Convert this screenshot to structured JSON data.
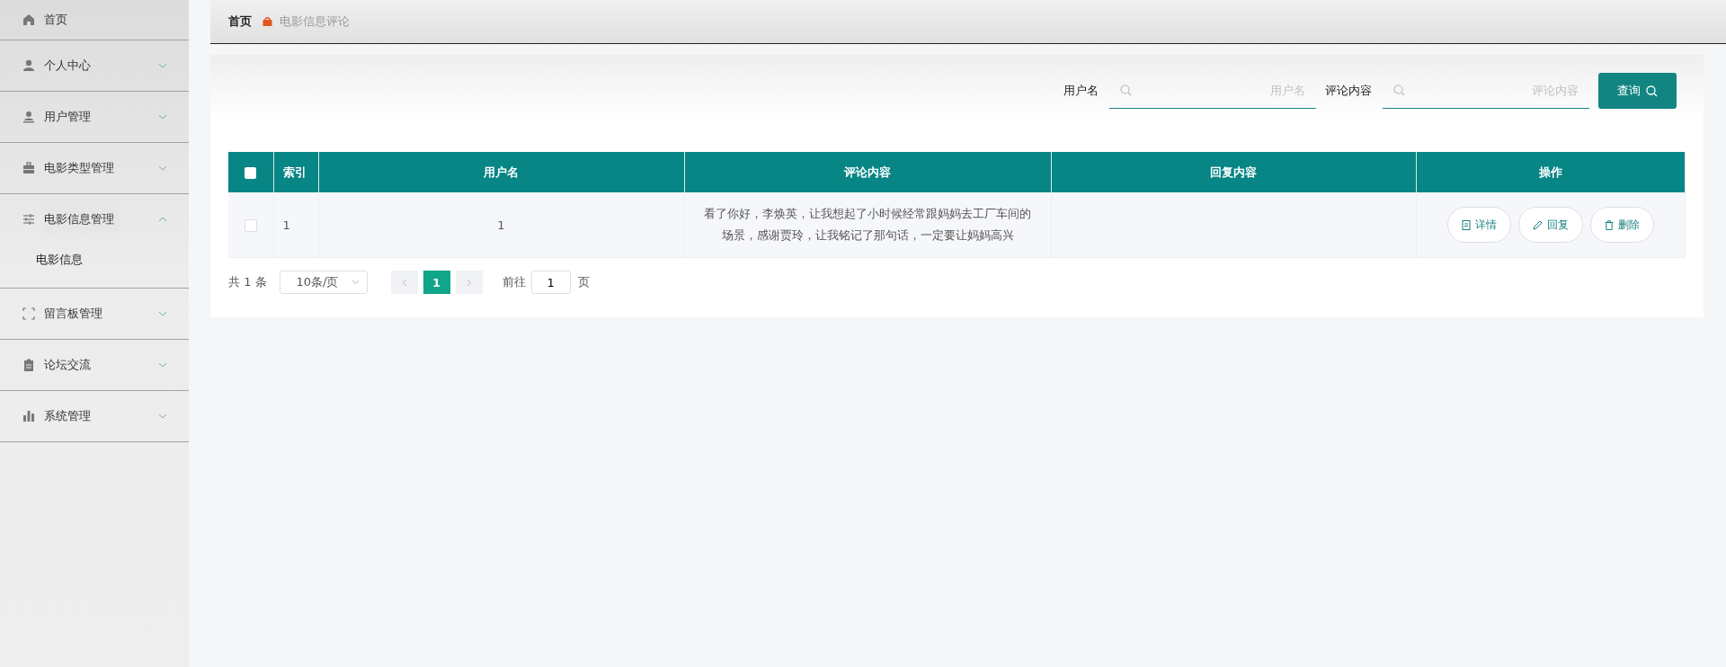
{
  "sidebar": {
    "items": [
      {
        "kind": "link",
        "label": "首页"
      },
      {
        "kind": "menu",
        "label": "个人中心",
        "expanded": false
      },
      {
        "kind": "menu",
        "label": "用户管理",
        "expanded": false
      },
      {
        "kind": "menu",
        "label": "电影类型管理",
        "expanded": false
      },
      {
        "kind": "menu",
        "label": "电影信息管理",
        "expanded": true,
        "children": [
          {
            "label": "电影信息"
          }
        ]
      },
      {
        "kind": "menu",
        "label": "留言板管理",
        "expanded": false
      },
      {
        "kind": "menu",
        "label": "论坛交流",
        "expanded": false
      },
      {
        "kind": "menu",
        "label": "系统管理",
        "expanded": false
      }
    ]
  },
  "breadcrumb": [
    {
      "label": "首页"
    },
    {
      "label": "电影信息评论"
    }
  ],
  "search": {
    "fields": [
      {
        "label": "用户名",
        "placeholder": "用户名"
      },
      {
        "label": "评论内容",
        "placeholder": "评论内容"
      }
    ],
    "button": "查询"
  },
  "table": {
    "header_checked": false,
    "columns": [
      "索引",
      "用户名",
      "评论内容",
      "回复内容",
      "操作"
    ],
    "rows": [
      {
        "checked": false,
        "index": "1",
        "username": "1",
        "comment": "看了你好，李焕英，让我想起了小时候经常跟妈妈去工厂车间的场景，感谢贾玲，让我铭记了那句话，一定要让妈妈高兴",
        "actions": [
          {
            "kind": "detail",
            "label": "详情"
          },
          {
            "kind": "reply",
            "label": "回复"
          },
          {
            "kind": "delete",
            "label": "删除"
          }
        ]
      }
    ]
  },
  "pagination": {
    "total": "共 1 条",
    "page_size": "10条/页",
    "pages": [
      {
        "label": "1",
        "selected": true
      }
    ],
    "goto_label": "前往",
    "goto_value": "1",
    "page_suffix": "页"
  }
}
